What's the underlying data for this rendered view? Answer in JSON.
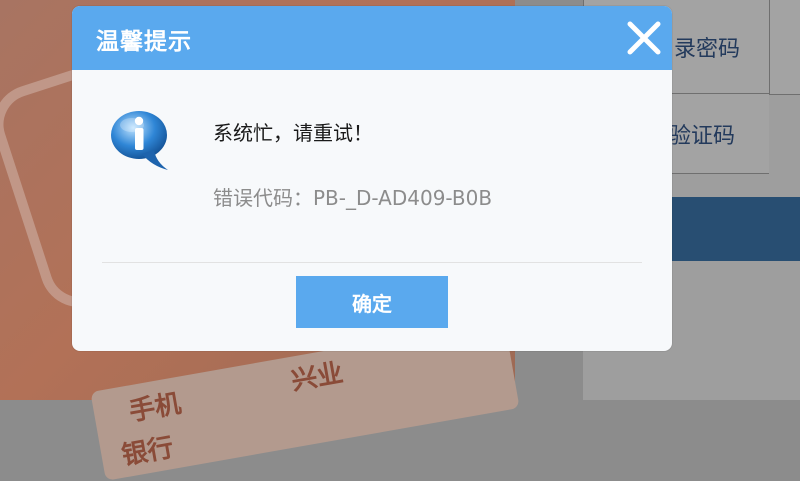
{
  "background": {
    "right_tabs": [
      "录密码",
      "验证码"
    ],
    "ticket_text": [
      "手机",
      "兴业",
      "银行"
    ]
  },
  "dialog": {
    "title": "温馨提示",
    "close_icon": "close-icon",
    "info_icon": "info-speech-bubble-icon",
    "message": "系统忙，请重试！",
    "error_code": "错误代码：PB-_D-AD409-B0B",
    "confirm_label": "确定"
  },
  "colors": {
    "accent": "#5aa9ee",
    "dialog_bg": "#f7f9fb",
    "error_text": "#8c8c8c"
  }
}
